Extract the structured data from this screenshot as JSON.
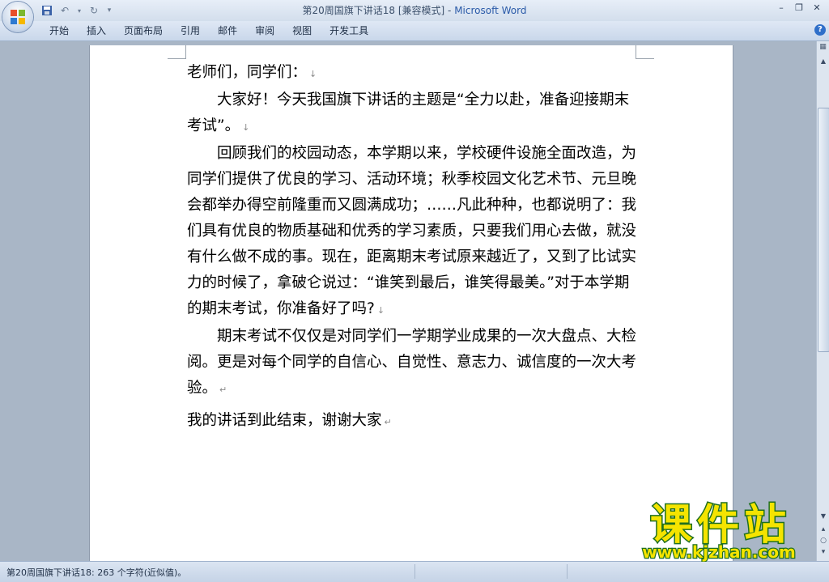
{
  "window": {
    "title_doc": "第20周国旗下讲话18 [兼容模式]",
    "title_sep": " - ",
    "title_app": "Microsoft Word"
  },
  "qat": {
    "save_icon": "save-icon",
    "undo_icon": "undo-icon",
    "redo_icon": "redo-icon",
    "customize_icon": "chevron-down-icon"
  },
  "ribbon": {
    "tabs": [
      "开始",
      "插入",
      "页面布局",
      "引用",
      "邮件",
      "审阅",
      "视图",
      "开发工具"
    ]
  },
  "document": {
    "paragraphs": [
      {
        "text": "老师们，同学们：",
        "mark": "↓"
      },
      {
        "text": "大家好！今天我国旗下讲话的主题是“全力以赴，准备迎接期末考试”。",
        "mark": "↓"
      },
      {
        "text": "回顾我们的校园动态，本学期以来，学校硬件设施全面改造，为同学们提供了优良的学习、活动环境；秋季校园文化艺术节、元旦晚会都举办得空前隆重而又圆满成功；……凡此种种，也都说明了：我们具有优良的物质基础和优秀的学习素质，只要我们用心去做，就没有什么做不成的事。现在，距离期末考试原来越近了，又到了比试实力的时候了，拿破仑说过：“谁笑到最后，谁笑得最美。”对于本学期的期末考试，你准备好了吗?",
        "mark": "↓"
      },
      {
        "text": "期末考试不仅仅是对同学们一学期学业成果的一次大盘点、大检阅。更是对每个同学的自信心、自觉性、意志力、诚信度的一次大考验。",
        "mark": "↵"
      },
      {
        "text": "我的讲话到此结束，谢谢大家",
        "mark": "↵"
      }
    ]
  },
  "statusbar": {
    "text": "第20周国旗下讲话18: 263 个字符(近似值)。"
  },
  "watermark": {
    "logo_text": "课件站",
    "url": "www.kjzhan.com"
  },
  "colors": {
    "title_app": "#2a5aa8",
    "ribbon_bg": "#d3deec",
    "watermark_yellow": "#f5e400",
    "watermark_green": "#1f6f1f"
  }
}
